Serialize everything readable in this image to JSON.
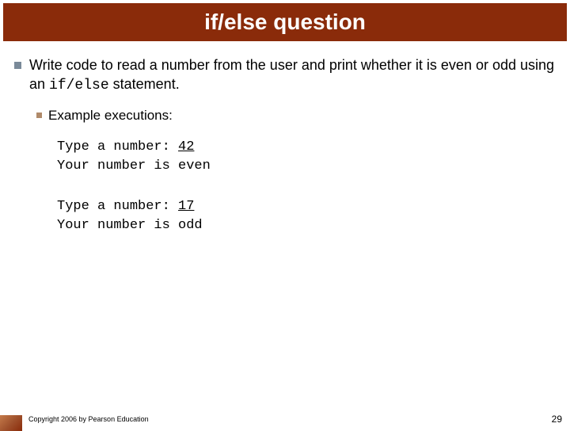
{
  "title": "if/else question",
  "bullet1_a": "Write code to read a number from the user and print whether it is even or odd using an ",
  "bullet1_code": "if/else",
  "bullet1_b": " statement.",
  "bullet2": "Example executions:",
  "ex1_l1a": "Type a number: ",
  "ex1_l1b": "42",
  "ex1_l2": "Your number is even",
  "ex2_l1a": "Type a number: ",
  "ex2_l1b": "17",
  "ex2_l2": "Your number is odd",
  "copyright": "Copyright 2006 by Pearson Education",
  "page": "29"
}
